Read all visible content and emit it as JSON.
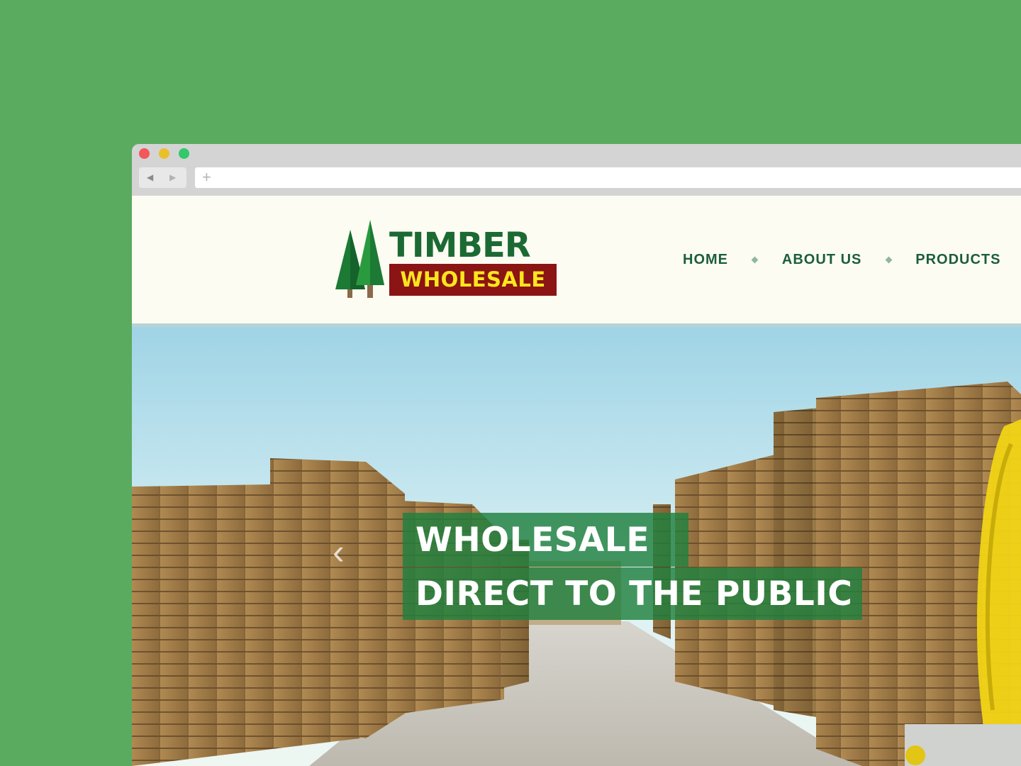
{
  "browser": {
    "window_controls": [
      "close",
      "minimize",
      "maximize"
    ],
    "back_icon": "◀",
    "forward_icon": "▶",
    "new_tab_icon": "+",
    "url": ""
  },
  "site": {
    "logo": {
      "line1": "TIMBER",
      "line2": "WHOLESALE",
      "colors": {
        "green": "#1c6a33",
        "red": "#8b1414",
        "yellow": "#fbe51d"
      }
    },
    "nav": {
      "items": [
        {
          "label": "HOME"
        },
        {
          "label": "ABOUT US"
        },
        {
          "label": "PRODUCTS"
        }
      ]
    },
    "hero": {
      "headline_line1": "WHOLESALE",
      "headline_line2": "DIRECT TO THE PUBLIC",
      "prev_arrow": "‹"
    }
  },
  "colors": {
    "page_background": "#5aab5f",
    "nav_text": "#1c5e3a",
    "caption_background": "#20803e"
  }
}
